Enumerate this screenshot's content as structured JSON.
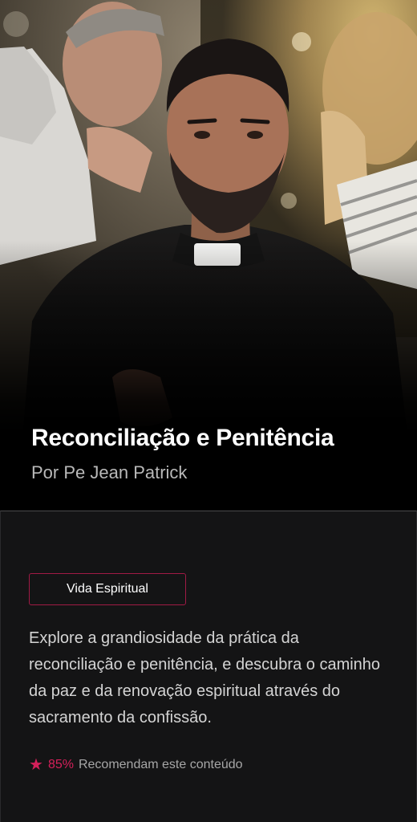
{
  "hero": {
    "title": "Reconciliação e Penitência",
    "author": "Por Pe Jean Patrick"
  },
  "content": {
    "category": "Vida Espiritual",
    "description": "Explore a grandiosidade da prática da reconciliação e penitência, e descubra o caminho da paz e da renovação espiritual através do sacramento da confissão.",
    "rating": {
      "icon": "star-icon",
      "percent": "85%",
      "label": "Recomendam este conteúdo"
    }
  },
  "colors": {
    "accent": "#d4205a",
    "tag_border": "#a01a45",
    "card_background": "#141415",
    "page_background": "#000000"
  }
}
